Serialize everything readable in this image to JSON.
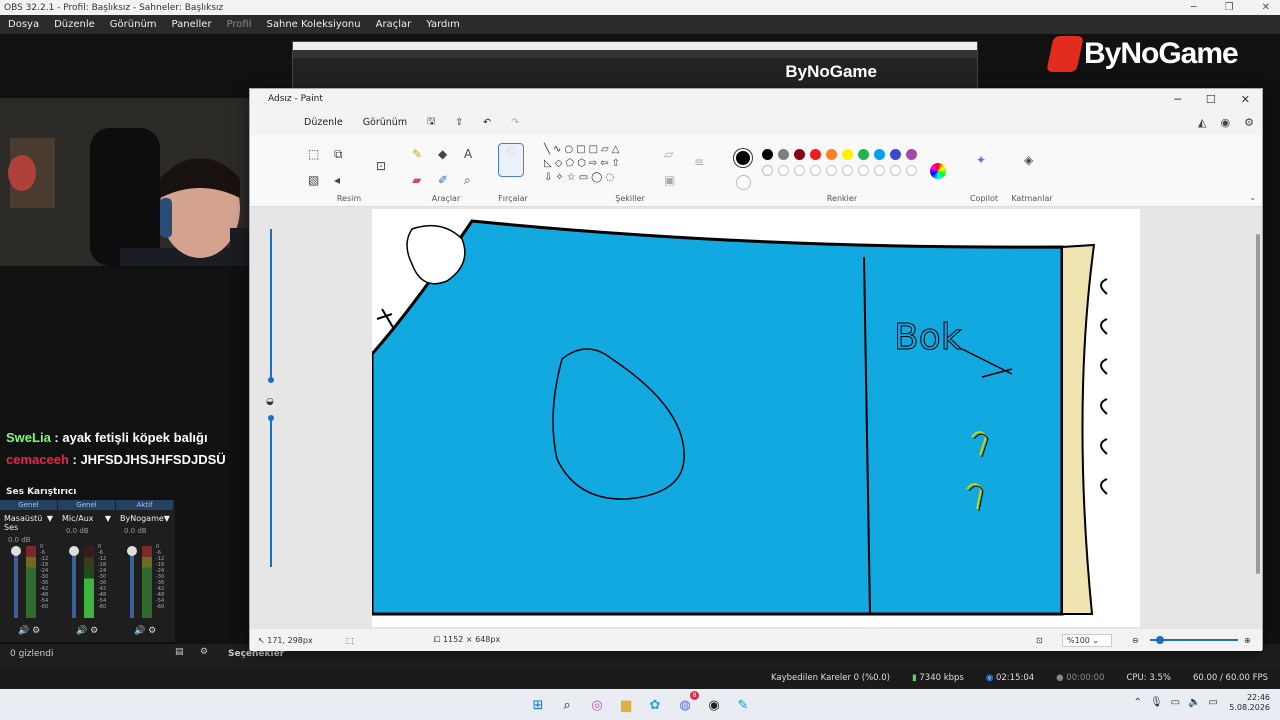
{
  "obs": {
    "title": "OBS 32.2.1 - Profil: Başlıksız - Sahneler: Başlıksız",
    "menu": [
      "Dosya",
      "Düzenle",
      "Görünüm",
      "Paneller",
      "Profil",
      "Sahne Koleksiyonu",
      "Araçlar",
      "Yardım"
    ],
    "menu_disabled_index": 4,
    "brand": "ByNoGame",
    "chat": [
      {
        "user": "SweLia",
        "message": ": ayak fetişli köpek balığı"
      },
      {
        "user": "cemaceeh",
        "message": ": JHFSDJHSJHFSDJDSÜ"
      }
    ],
    "mixer": {
      "title": "Ses Karıştırıcı",
      "channels": [
        {
          "tag": "Genel",
          "name": "Masaüstü Ses",
          "db": "0.0 dB"
        },
        {
          "tag": "Genel",
          "name": "Mic/Aux",
          "db": "0.0 dB"
        },
        {
          "tag": "Aktif",
          "name": "ByNogame",
          "db": "0.0 dB"
        }
      ],
      "ticks": [
        "0",
        "-6",
        "-12",
        "-18",
        "-24",
        "-30",
        "-36",
        "-42",
        "-48",
        "-54",
        "-60"
      ]
    },
    "hidden_count": "0 gizlendi",
    "options_label": "Seçenekler",
    "status": {
      "dropped": "Kaybedilen Kareler 0 (%0.0)",
      "bitrate": "7340 kbps",
      "stream_time": "02:15:04",
      "rec_time": "00:00:00",
      "cpu": "CPU: 3.5%",
      "fps": "60.00 / 60.00 FPS"
    }
  },
  "paint": {
    "title": "Adsız - Paint",
    "menu": [
      "Düzenle",
      "Görünüm"
    ],
    "groups": {
      "image": "Resim",
      "tools": "Araçlar",
      "brushes": "Fırçalar",
      "shapes": "Şekiller",
      "colors": "Renkler",
      "copilot": "Copilot",
      "layers": "Katmanlar"
    },
    "palette_row1": [
      "#000000",
      "#7f7f7f",
      "#880015",
      "#ed1c24",
      "#ff7f27",
      "#fff200",
      "#22b14c",
      "#00a2e8",
      "#3f48cc",
      "#a349a4"
    ],
    "palette_row2": [
      "#ffffff",
      "#c3c3c3",
      "#b97a57",
      "#ffaec9",
      "#ffc90e",
      "#efe4b0",
      "#b5e61d",
      "#99d9ea",
      "#7092be",
      "#c8bfe7"
    ],
    "canvas_text": "Bok",
    "status": {
      "cursor": "171, 298px",
      "size": "1152 × 648px",
      "zoom": "%100"
    },
    "colors": {
      "sea": "#12a8e0",
      "sand": "#efe4b0"
    }
  },
  "taskbar": {
    "time": "22:46",
    "date": "5.08.2026",
    "badge": "8"
  }
}
